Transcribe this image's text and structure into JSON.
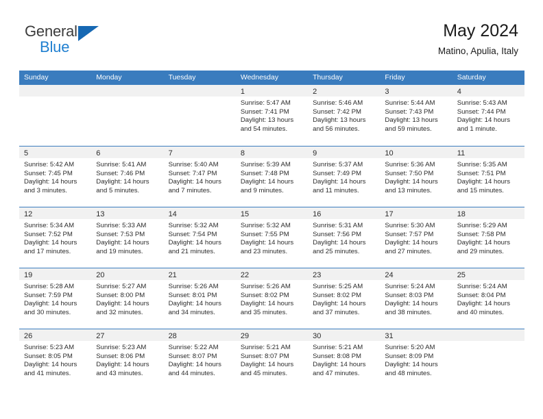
{
  "brand": {
    "general": "General",
    "blue": "Blue",
    "triangle_color": "#1668b3"
  },
  "header": {
    "title": "May 2024",
    "subtitle": "Matino, Apulia, Italy"
  },
  "theme": {
    "header_row_bg": "#3a7cbe",
    "day_band_bg": "#f1f1f1",
    "grid_line": "#3a7cbe",
    "text": "#2b2b2b"
  },
  "weekday_headers": [
    "Sunday",
    "Monday",
    "Tuesday",
    "Wednesday",
    "Thursday",
    "Friday",
    "Saturday"
  ],
  "weeks": [
    [
      {
        "day": "",
        "empty": true
      },
      {
        "day": "",
        "empty": true
      },
      {
        "day": "",
        "empty": true
      },
      {
        "day": "1",
        "sunrise": "Sunrise: 5:47 AM",
        "sunset": "Sunset: 7:41 PM",
        "daylight": "Daylight: 13 hours and 54 minutes."
      },
      {
        "day": "2",
        "sunrise": "Sunrise: 5:46 AM",
        "sunset": "Sunset: 7:42 PM",
        "daylight": "Daylight: 13 hours and 56 minutes."
      },
      {
        "day": "3",
        "sunrise": "Sunrise: 5:44 AM",
        "sunset": "Sunset: 7:43 PM",
        "daylight": "Daylight: 13 hours and 59 minutes."
      },
      {
        "day": "4",
        "sunrise": "Sunrise: 5:43 AM",
        "sunset": "Sunset: 7:44 PM",
        "daylight": "Daylight: 14 hours and 1 minute."
      }
    ],
    [
      {
        "day": "5",
        "sunrise": "Sunrise: 5:42 AM",
        "sunset": "Sunset: 7:45 PM",
        "daylight": "Daylight: 14 hours and 3 minutes."
      },
      {
        "day": "6",
        "sunrise": "Sunrise: 5:41 AM",
        "sunset": "Sunset: 7:46 PM",
        "daylight": "Daylight: 14 hours and 5 minutes."
      },
      {
        "day": "7",
        "sunrise": "Sunrise: 5:40 AM",
        "sunset": "Sunset: 7:47 PM",
        "daylight": "Daylight: 14 hours and 7 minutes."
      },
      {
        "day": "8",
        "sunrise": "Sunrise: 5:39 AM",
        "sunset": "Sunset: 7:48 PM",
        "daylight": "Daylight: 14 hours and 9 minutes."
      },
      {
        "day": "9",
        "sunrise": "Sunrise: 5:37 AM",
        "sunset": "Sunset: 7:49 PM",
        "daylight": "Daylight: 14 hours and 11 minutes."
      },
      {
        "day": "10",
        "sunrise": "Sunrise: 5:36 AM",
        "sunset": "Sunset: 7:50 PM",
        "daylight": "Daylight: 14 hours and 13 minutes."
      },
      {
        "day": "11",
        "sunrise": "Sunrise: 5:35 AM",
        "sunset": "Sunset: 7:51 PM",
        "daylight": "Daylight: 14 hours and 15 minutes."
      }
    ],
    [
      {
        "day": "12",
        "sunrise": "Sunrise: 5:34 AM",
        "sunset": "Sunset: 7:52 PM",
        "daylight": "Daylight: 14 hours and 17 minutes."
      },
      {
        "day": "13",
        "sunrise": "Sunrise: 5:33 AM",
        "sunset": "Sunset: 7:53 PM",
        "daylight": "Daylight: 14 hours and 19 minutes."
      },
      {
        "day": "14",
        "sunrise": "Sunrise: 5:32 AM",
        "sunset": "Sunset: 7:54 PM",
        "daylight": "Daylight: 14 hours and 21 minutes."
      },
      {
        "day": "15",
        "sunrise": "Sunrise: 5:32 AM",
        "sunset": "Sunset: 7:55 PM",
        "daylight": "Daylight: 14 hours and 23 minutes."
      },
      {
        "day": "16",
        "sunrise": "Sunrise: 5:31 AM",
        "sunset": "Sunset: 7:56 PM",
        "daylight": "Daylight: 14 hours and 25 minutes."
      },
      {
        "day": "17",
        "sunrise": "Sunrise: 5:30 AM",
        "sunset": "Sunset: 7:57 PM",
        "daylight": "Daylight: 14 hours and 27 minutes."
      },
      {
        "day": "18",
        "sunrise": "Sunrise: 5:29 AM",
        "sunset": "Sunset: 7:58 PM",
        "daylight": "Daylight: 14 hours and 29 minutes."
      }
    ],
    [
      {
        "day": "19",
        "sunrise": "Sunrise: 5:28 AM",
        "sunset": "Sunset: 7:59 PM",
        "daylight": "Daylight: 14 hours and 30 minutes."
      },
      {
        "day": "20",
        "sunrise": "Sunrise: 5:27 AM",
        "sunset": "Sunset: 8:00 PM",
        "daylight": "Daylight: 14 hours and 32 minutes."
      },
      {
        "day": "21",
        "sunrise": "Sunrise: 5:26 AM",
        "sunset": "Sunset: 8:01 PM",
        "daylight": "Daylight: 14 hours and 34 minutes."
      },
      {
        "day": "22",
        "sunrise": "Sunrise: 5:26 AM",
        "sunset": "Sunset: 8:02 PM",
        "daylight": "Daylight: 14 hours and 35 minutes."
      },
      {
        "day": "23",
        "sunrise": "Sunrise: 5:25 AM",
        "sunset": "Sunset: 8:02 PM",
        "daylight": "Daylight: 14 hours and 37 minutes."
      },
      {
        "day": "24",
        "sunrise": "Sunrise: 5:24 AM",
        "sunset": "Sunset: 8:03 PM",
        "daylight": "Daylight: 14 hours and 38 minutes."
      },
      {
        "day": "25",
        "sunrise": "Sunrise: 5:24 AM",
        "sunset": "Sunset: 8:04 PM",
        "daylight": "Daylight: 14 hours and 40 minutes."
      }
    ],
    [
      {
        "day": "26",
        "sunrise": "Sunrise: 5:23 AM",
        "sunset": "Sunset: 8:05 PM",
        "daylight": "Daylight: 14 hours and 41 minutes."
      },
      {
        "day": "27",
        "sunrise": "Sunrise: 5:23 AM",
        "sunset": "Sunset: 8:06 PM",
        "daylight": "Daylight: 14 hours and 43 minutes."
      },
      {
        "day": "28",
        "sunrise": "Sunrise: 5:22 AM",
        "sunset": "Sunset: 8:07 PM",
        "daylight": "Daylight: 14 hours and 44 minutes."
      },
      {
        "day": "29",
        "sunrise": "Sunrise: 5:21 AM",
        "sunset": "Sunset: 8:07 PM",
        "daylight": "Daylight: 14 hours and 45 minutes."
      },
      {
        "day": "30",
        "sunrise": "Sunrise: 5:21 AM",
        "sunset": "Sunset: 8:08 PM",
        "daylight": "Daylight: 14 hours and 47 minutes."
      },
      {
        "day": "31",
        "sunrise": "Sunrise: 5:20 AM",
        "sunset": "Sunset: 8:09 PM",
        "daylight": "Daylight: 14 hours and 48 minutes."
      },
      {
        "day": "",
        "empty": true
      }
    ]
  ]
}
